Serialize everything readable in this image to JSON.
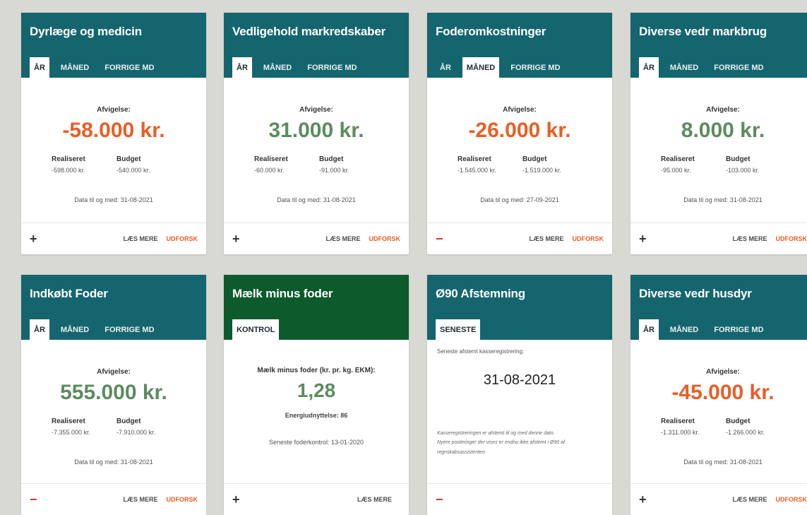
{
  "labels": {
    "afvigelse": "Afvigelse:",
    "realiseret": "Realiseret",
    "budget": "Budget",
    "laes_mere": "LÆS MERE",
    "udforsk": "UDFORSK",
    "plus": "+",
    "minus": "−"
  },
  "tabs": {
    "aar": "ÅR",
    "maaned": "MÅNED",
    "forrige": "FORRIGE MD",
    "kontrol": "KONTROL",
    "seneste": "SENESTE"
  },
  "cards": [
    {
      "title": "Dyrlæge og medicin",
      "value": "-58.000 kr.",
      "realiseret": "-598.000 kr.",
      "budget": "-540.000 kr.",
      "note": "Data til og med: 31-08-2021"
    },
    {
      "title": "Vedligehold markredskaber",
      "value": "31.000 kr.",
      "realiseret": "-60.000 kr.",
      "budget": "-91.000 kr.",
      "note": "Data til og med: 31-08-2021"
    },
    {
      "title": "Foderomkostninger",
      "value": "-26.000 kr.",
      "realiseret": "-1.545.000 kr.",
      "budget": "-1.519.000 kr.",
      "note": "Data til og med: 27-09-2021"
    },
    {
      "title": "Diverse vedr markbrug",
      "value": "8.000 kr.",
      "realiseret": "-95.000 kr.",
      "budget": "-103.000 kr.",
      "note": "Data til og med: 31-08-2021"
    },
    {
      "title": "Indkøbt Foder",
      "value": "555.000 kr.",
      "realiseret": "-7.355.000 kr.",
      "budget": "-7.910.000 kr.",
      "note": "Data til og med: 31-08-2021"
    },
    {
      "title": "Mælk minus foder",
      "label": "Mælk minus foder (kr. pr. kg. EKM):",
      "value": "1,28",
      "sub": "Energiudnyttelse: 86",
      "note": "Seneste foderkontrol: 13-01-2020"
    },
    {
      "title": "Ø90 Afstemning",
      "top": "Seneste afstemt kasseregistrering:",
      "date": "31-08-2021",
      "note1": "Kasseregistreringen er afstemt til og med denne dato.",
      "note2": "Nyere posteringer der vises er endnu ikke afstemt i Ø90 af",
      "note3": "regnskabsassistenten."
    },
    {
      "title": "Diverse vedr husdyr",
      "value": "-45.000 kr.",
      "realiseret": "-1.311.000 kr.",
      "budget": "-1.266.000 kr.",
      "note": "Data til og med: 31-08-2021"
    }
  ]
}
